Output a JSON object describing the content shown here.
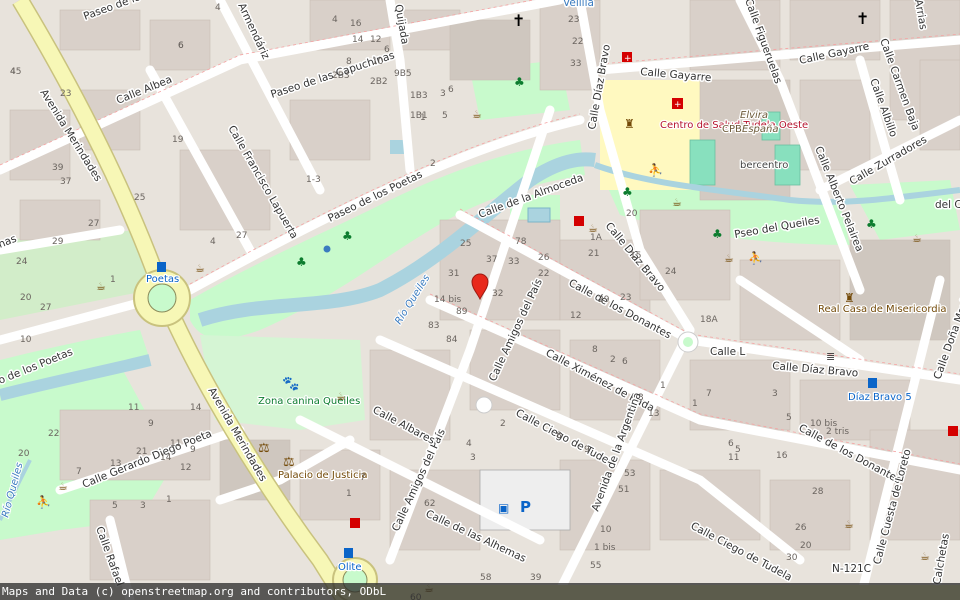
{
  "colors": {
    "background": "#e8e3dc",
    "building": "#d9d0c9",
    "park": "#c8facc",
    "water": "#aad3df",
    "primary_road": "#f7f7b6",
    "primary_casing": "#c9c27e",
    "secondary_road": "#ffffff",
    "school": "#fff9c0",
    "marker": "#e8291c"
  },
  "streets": {
    "paseo_de_las_capuchinas": "Paseo de las Capuchinas",
    "paseo_top": "Paseo de lo",
    "armendariz": "Armendáriz",
    "quijada": "Quijada",
    "velilla": "Velilla",
    "calle_albea": "Calle Albea",
    "avenida_merindades_1": "Avenida Merindades",
    "avenida_merindades_2": "Avenida Merindades",
    "calle_francisco_lapuerta": "Calle Francisco Lapuerta",
    "paseo_de_los_poetas_1": "Paseo de los Poetas",
    "paseo_de_los_poetas_2": "o de los Poetas",
    "calle_de_la_almoceda": "Calle de la Almoceda",
    "calle_diaz_bravo_1": "Calle Díaz Bravo",
    "calle_diaz_bravo_2": "Calle Díaz Bravo",
    "calle_diaz_bravo_3": "Calle Díaz Bravo",
    "calle_gayarre_1": "Calle Gayarre",
    "calle_gayarre_2": "Calle Gayarre",
    "calle_figueruelas": "Calle Figueruelas",
    "calle_carmen_baja": "Calle Carmen Baja",
    "calle_albillo": "Calle Albillo",
    "calle_zurradores": "Calle Zurradores",
    "calle_alberto_pelairea": "Calle Alberto Pelairea",
    "pseo_del_queiles": "Pseo del Queiles",
    "calle_de_los_donantes_1": "Calle de los Donantes",
    "calle_de_los_donantes_2": "Calle de los Donantes",
    "calle_l": "Calle L",
    "calle_dona_maria": "Calle Doña María",
    "calle_amigos_del_pais_1": "Calle Amigos del País",
    "calle_amigos_del_pais_2": "Calle Amigos del País",
    "calle_ximenez_de_rada": "Calle Ximénez de Rada",
    "calle_ciego_de_tudela_1": "Calle Ciego de Tudela",
    "calle_ciego_de_tudela_2": "Calle Ciego de Tudela",
    "avenida_de_la_argentina": "Avenida de la Argentina",
    "calle_albares": "Calle Albares",
    "calle_gerardo_diego_poeta": "Calle Gerardo Diego Poeta",
    "calle_rafael": "Calle Rafael",
    "calle_de_las_alhemas": "Calle de las Alhemas",
    "calle_cuesta_de_loreto": "Calle Cuesta de Loreto",
    "calchetas": "Calchetas",
    "n121c": "N-121C",
    "avenida_bottom": "Avenida Merindades",
    "calle_arrias": "Arrias",
    "del_c": "del C",
    "rio_queiles_1": "Río Queiles",
    "rio_queiles_2": "Río Queiles",
    "nas": "nas"
  },
  "pois": {
    "centro_de_salud": "Centro de Salud Tudela Oeste",
    "cpb_elvira": "Elvira",
    "cpb_label": "CPB",
    "cpb_espana": "España",
    "bercentro": "bercentro",
    "real_casa": "Real Casa de Misericordia",
    "zona_canina": "Zona canina Queiles",
    "palacio_justicia": "Palacio de Justicia",
    "poetas_stop": "Poetas",
    "olite_stop": "Olite",
    "diaz_bravo_stop": "Díaz Bravo 5"
  },
  "house_numbers": [
    "45",
    "6",
    "4",
    "4",
    "16",
    "14",
    "12",
    "10",
    "8",
    "6",
    "2B3",
    "9B5",
    "2B2",
    "1B3",
    "1B1",
    "1",
    "3",
    "5",
    "2",
    "6",
    "23",
    "33",
    "22",
    "23",
    "1-3",
    "39",
    "37",
    "25",
    "27",
    "19",
    "29",
    "24",
    "20",
    "10",
    "4",
    "1",
    "27",
    "25",
    "37",
    "33",
    "31",
    "32",
    "14 bis",
    "89",
    "83",
    "84",
    "78",
    "26",
    "22",
    "12",
    "29",
    "23",
    "21",
    "1A",
    "15",
    "20",
    "24",
    "18A",
    "8",
    "2",
    "6",
    "1",
    "3",
    "13",
    "1",
    "7",
    "6",
    "11",
    "5",
    "3",
    "5",
    "10 bis",
    "2 tris",
    "16",
    "28",
    "26",
    "20",
    "30",
    "53",
    "51",
    "10",
    "1 bis",
    "55",
    "2",
    "4",
    "3",
    "8",
    "9",
    "7",
    "1",
    "62",
    "60",
    "58",
    "39",
    "27",
    "22",
    "20",
    "21",
    "13",
    "11",
    "9",
    "7",
    "5",
    "3",
    "1",
    "14",
    "11",
    "9",
    "14",
    "12",
    "4",
    "6"
  ],
  "attribution": "Maps and Data (c) openstreetmap.org and contributors, ODbL"
}
